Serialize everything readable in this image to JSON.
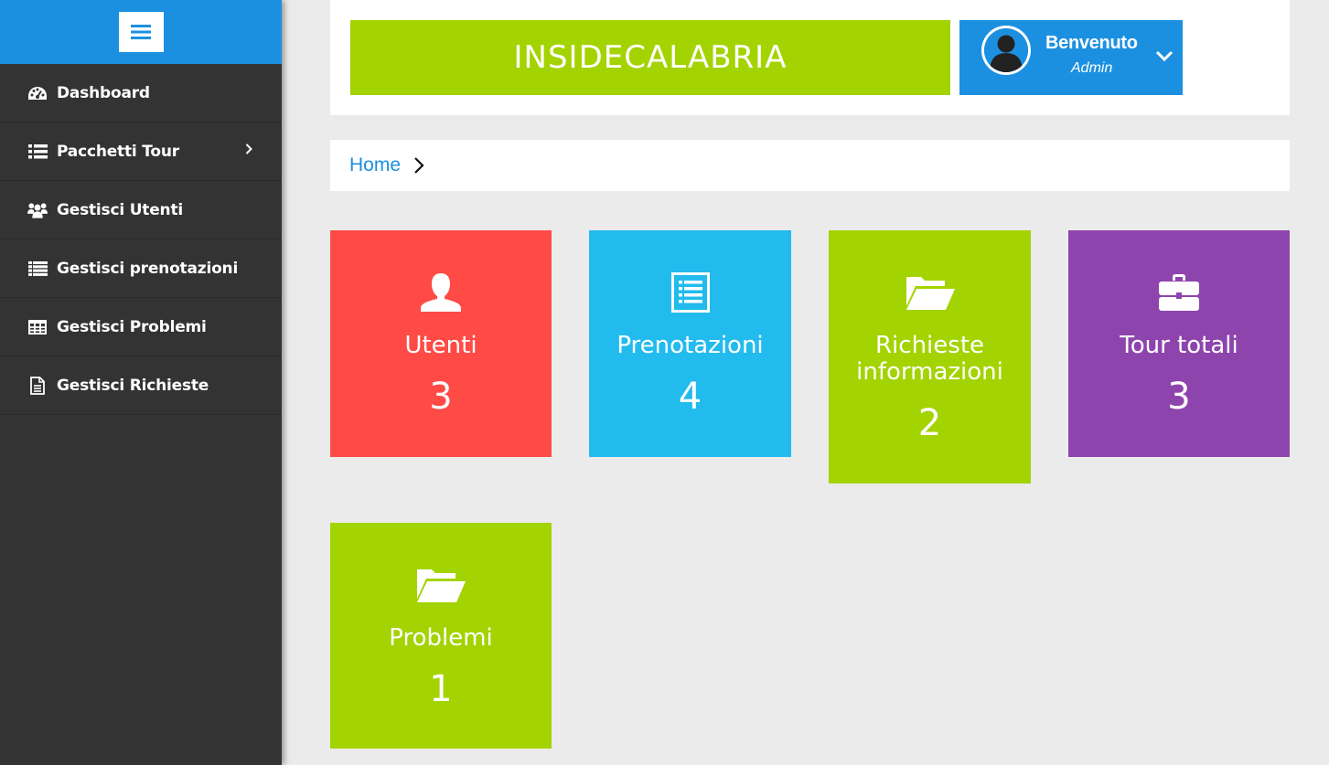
{
  "sidebar": {
    "toggle_icon": "hamburger-icon",
    "items": [
      {
        "label": "Dashboard",
        "icon": "dashboard-icon"
      },
      {
        "label": "Pacchetti Tour",
        "icon": "list-icon",
        "has_submenu": true
      },
      {
        "label": "Gestisci Utenti",
        "icon": "users-icon"
      },
      {
        "label": "Gestisci prenotazioni",
        "icon": "list-icon"
      },
      {
        "label": "Gestisci Problemi",
        "icon": "table-icon"
      },
      {
        "label": "Gestisci Richieste",
        "icon": "document-icon"
      }
    ]
  },
  "header": {
    "brand": "INSIDECALABRIA",
    "user": {
      "welcome": "Benvenuto",
      "role": "Admin"
    }
  },
  "breadcrumb": {
    "home": "Home"
  },
  "tiles": [
    {
      "label": "Utenti",
      "count": "3",
      "icon": "user-icon",
      "color": "#ff4a45"
    },
    {
      "label": "Prenotazioni",
      "count": "4",
      "icon": "list-box-icon",
      "color": "#22bbee"
    },
    {
      "label": "Richieste informazioni",
      "count": "2",
      "icon": "folder-open-icon",
      "color": "#a3d300"
    },
    {
      "label": "Tour totali",
      "count": "3",
      "icon": "briefcase-icon",
      "color": "#8e44ad"
    },
    {
      "label": "Problemi",
      "count": "1",
      "icon": "folder-open-icon",
      "color": "#a3d300"
    }
  ],
  "colors": {
    "accent_blue": "#1c90e0",
    "sidebar_bg": "#333333",
    "brand_green": "#a3d300",
    "page_bg": "#ebebeb"
  }
}
